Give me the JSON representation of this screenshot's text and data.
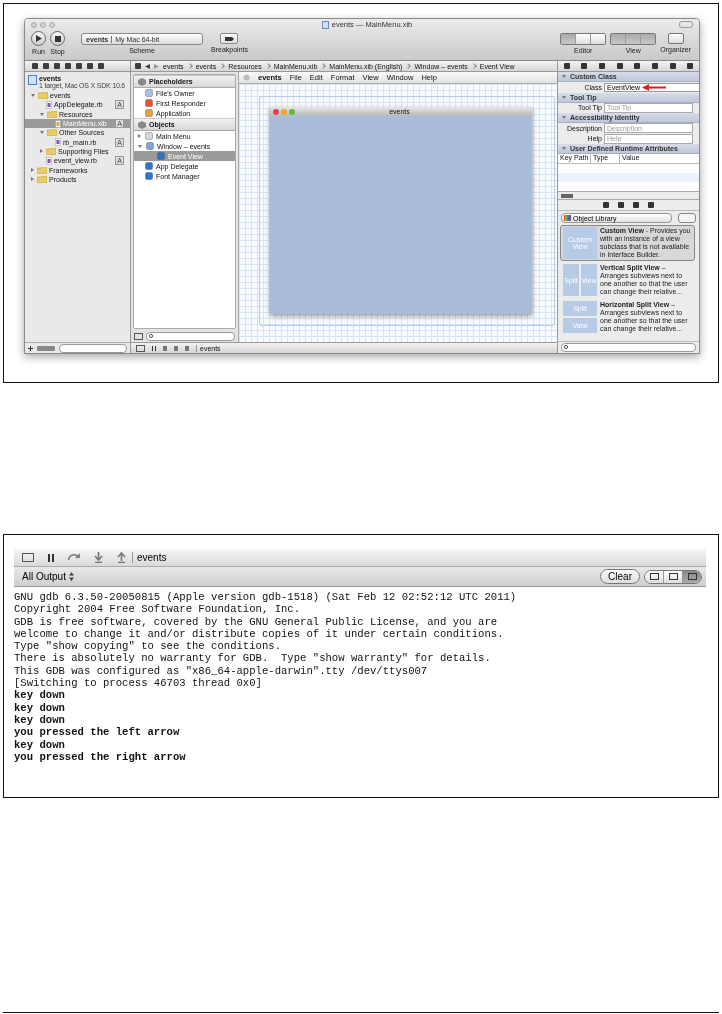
{
  "xcode_window": {
    "title": "events — MainMenu.xib",
    "toolbar": {
      "run": "Run",
      "stop": "Stop",
      "scheme_target": "events",
      "scheme_destination": "My Mac 64-bit",
      "scheme": "Scheme",
      "breakpoints": "Breakpoints",
      "editor": "Editor",
      "view": "View",
      "organizer": "Organizer"
    },
    "breadcrumbs": [
      "events",
      "events",
      "Resources",
      "MainMenu.xib",
      "MainMenu.xib (English)",
      "Window – events",
      "Event View"
    ],
    "navigator": {
      "project": {
        "name": "events",
        "subtitle": "1 target, Mac OS X SDK 10.6"
      },
      "tree": [
        {
          "name": "events",
          "kind": "folder",
          "expanded": true,
          "selected": false,
          "children": [
            {
              "name": "AppDelegate.rb",
              "kind": "file",
              "selected": false,
              "badge": "A"
            },
            {
              "name": "Resources",
              "kind": "folder",
              "expanded": true,
              "selected": false,
              "children": [
                {
                  "name": "MainMenu.xib",
                  "kind": "xib",
                  "selected": true,
                  "badge": "A"
                }
              ]
            },
            {
              "name": "Other Sources",
              "kind": "folder",
              "expanded": true,
              "selected": false,
              "children": [
                {
                  "name": "rb_main.rb",
                  "kind": "file",
                  "selected": false,
                  "badge": "A"
                }
              ]
            },
            {
              "name": "Supporting Files",
              "kind": "folder",
              "expanded": false,
              "selected": false
            },
            {
              "name": "event_view.rb",
              "kind": "file",
              "selected": false,
              "badge": "A"
            }
          ]
        },
        {
          "name": "Frameworks",
          "kind": "folder",
          "expanded": false,
          "selected": false
        },
        {
          "name": "Products",
          "kind": "folder",
          "expanded": false,
          "selected": false
        }
      ]
    },
    "document_outline": [
      {
        "title": "Placeholders",
        "items": [
          {
            "name": "File's Owner",
            "kind": "owner",
            "selected": false
          },
          {
            "name": "First Responder",
            "kind": "responder",
            "selected": false
          },
          {
            "name": "Application",
            "kind": "application",
            "selected": false
          }
        ]
      },
      {
        "title": "Objects",
        "items": [
          {
            "name": "Main Menu",
            "kind": "menu",
            "expanded": false,
            "selected": false
          },
          {
            "name": "Window – events",
            "kind": "window",
            "expanded": true,
            "selected": false,
            "children": [
              {
                "name": "Event View",
                "kind": "view",
                "selected": true
              }
            ]
          },
          {
            "name": "App Delegate",
            "kind": "object",
            "selected": false
          },
          {
            "name": "Font Manager",
            "kind": "object",
            "selected": false
          }
        ]
      }
    ],
    "canvas": {
      "menu": [
        "events",
        "File",
        "Edit",
        "Format",
        "View",
        "Window",
        "Help"
      ],
      "window_title": "events"
    },
    "inspector": {
      "sections": [
        {
          "title": "Custom Class",
          "fields": [
            {
              "label": "Class",
              "value": "EventView",
              "kind": "combo"
            }
          ]
        },
        {
          "title": "Tool Tip",
          "fields": [
            {
              "label": "Tool Tip",
              "placeholder": "Tool Tip",
              "kind": "text"
            }
          ]
        },
        {
          "title": "Accessibility Identity",
          "fields": [
            {
              "label": "Description",
              "placeholder": "Description",
              "kind": "text"
            },
            {
              "label": "Help",
              "placeholder": "Help",
              "kind": "text"
            }
          ]
        },
        {
          "title": "User Defined Runtime Attributes",
          "columns": [
            "Key Path",
            "Type",
            "Value"
          ]
        }
      ]
    },
    "library": {
      "selector": "Object Library",
      "items": [
        {
          "thumb": [
            "Custom View"
          ],
          "kind": "single",
          "description": "**Custom View** - Provides you with an instance of a view subclass that is not available in Interface Builder.",
          "selected": true
        },
        {
          "thumb": [
            "Split",
            "View"
          ],
          "kind": "vertical",
          "description": "**Vertical Split View** – Arranges subviews next to one another so that the user can change their relative...",
          "selected": false
        },
        {
          "thumb": [
            "Split",
            "View"
          ],
          "kind": "horizontal",
          "description": "**Horizontal Split View** – Arranges subviews next to one another so that the user can change their relative...",
          "selected": false
        }
      ]
    },
    "debug_bar": {
      "process": "events"
    }
  },
  "debug_area": {
    "process": "events",
    "output_filter": "All Output",
    "clear": "Clear",
    "layouts": [
      {
        "selected": false
      },
      {
        "selected": false
      },
      {
        "selected": true
      }
    ],
    "console": [
      {
        "text": "GNU gdb 6.3.50-20050815 (Apple version gdb-1518) (Sat Feb 12 02:52:12 UTC 2011)",
        "kind": "gdb"
      },
      {
        "text": "Copyright 2004 Free Software Foundation, Inc.",
        "kind": "gdb"
      },
      {
        "text": "GDB is free software, covered by the GNU General Public License, and you are",
        "kind": "gdb"
      },
      {
        "text": "welcome to change it and/or distribute copies of it under certain conditions.",
        "kind": "gdb"
      },
      {
        "text": "Type \"show copying\" to see the conditions.",
        "kind": "gdb"
      },
      {
        "text": "There is absolutely no warranty for GDB.  Type \"show warranty\" for details.",
        "kind": "gdb"
      },
      {
        "text": "This GDB was configured as \"x86_64-apple-darwin\".tty /dev/ttys007",
        "kind": "gdb"
      },
      {
        "text": "[Switching to process 46703 thread 0x0]",
        "kind": "gdb"
      },
      {
        "text": "key down",
        "kind": "program"
      },
      {
        "text": "key down",
        "kind": "program"
      },
      {
        "text": "key down",
        "kind": "program"
      },
      {
        "text": "you pressed the left arrow",
        "kind": "program"
      },
      {
        "text": "key down",
        "kind": "program"
      },
      {
        "text": "you pressed the right arrow",
        "kind": "program"
      }
    ]
  }
}
